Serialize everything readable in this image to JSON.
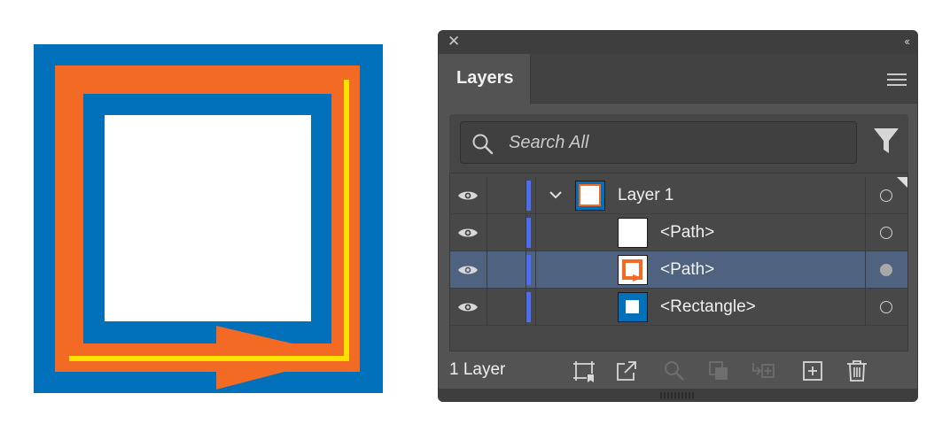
{
  "panel": {
    "tab_title": "Layers",
    "search_placeholder": "Search All",
    "layers": [
      {
        "label": "Layer 1",
        "visible": true,
        "expanded": true,
        "selected": false,
        "target": "empty",
        "thumbnail": "layer-composite"
      },
      {
        "label": "<Path>",
        "visible": true,
        "selected": false,
        "target": "empty",
        "thumbnail": "white-square"
      },
      {
        "label": "<Path>",
        "visible": true,
        "selected": true,
        "target": "filled",
        "thumbnail": "orange-arrow-path"
      },
      {
        "label": "<Rectangle>",
        "visible": true,
        "selected": false,
        "target": "empty",
        "thumbnail": "blue-rectangle"
      }
    ],
    "footer": {
      "layer_count": "1 Layer",
      "icons": [
        "artboard-collect-icon",
        "export-icon",
        "locate-object-icon",
        "clipping-mask-icon",
        "sublayer-icon",
        "new-layer-icon",
        "trash-icon"
      ]
    }
  },
  "colors": {
    "artwork_blue": "#0070bb",
    "artwork_orange": "#f26a23",
    "artwork_yellow": "#ffe100",
    "layer_color_bar": "#4b6ef5",
    "selected_row": "#4f6380"
  }
}
